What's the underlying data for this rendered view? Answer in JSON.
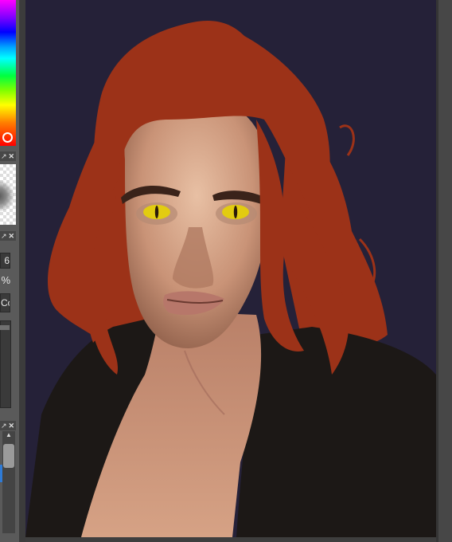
{
  "color_panel": {
    "hue_strip": "hue-gradient",
    "accent": "#ff0000"
  },
  "brush_panel": {
    "dock_icon": "dock-icon",
    "close_icon": "close-icon",
    "dock_glyph": "↗",
    "close_glyph": "✕"
  },
  "options_panel": {
    "size_value": "6",
    "opacity_unit": "%",
    "mode_label": "Co",
    "dock_glyph": "↗",
    "close_glyph": "✕"
  },
  "layers_panel": {
    "dock_glyph": "↗",
    "close_glyph": "✕",
    "scroll_up_glyph": "▲"
  },
  "canvas": {
    "background": "#252138",
    "hair_color": "#9c3218",
    "jacket_color": "#1c1816",
    "skin_color": "#c99377",
    "eye_color": "#e2cc10"
  }
}
